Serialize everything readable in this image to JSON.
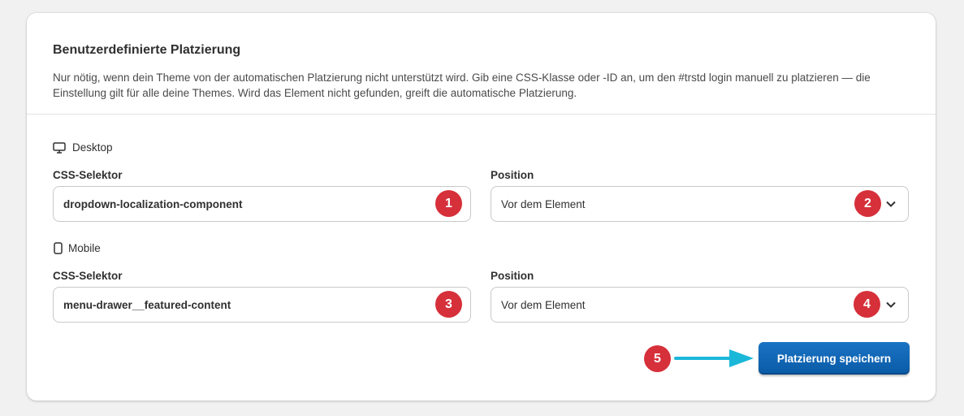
{
  "placement": {
    "title": "Benutzerdefinierte Platzierung",
    "description": "Nur nötig, wenn dein Theme von der automatischen Platzierung nicht unterstützt wird. Gib eine CSS-Klasse oder -ID an, um den #trstd login manuell zu platzieren — die Einstellung gilt für alle deine Themes. Wird das Element nicht gefunden, greift die automatische Platzierung."
  },
  "desktop": {
    "label": "Desktop",
    "icon": "desktop-icon",
    "selector_label": "CSS-Selektor",
    "selector_value": "dropdown-localization-component",
    "position_label": "Position",
    "position_value": "Vor dem Element"
  },
  "mobile": {
    "label": "Mobile",
    "icon": "mobile-icon",
    "selector_label": "CSS-Selektor",
    "selector_value": "menu-drawer__featured-content",
    "position_label": "Position",
    "position_value": "Vor dem Element"
  },
  "save_label": "Platzierung speichern",
  "annotations": [
    "1",
    "2",
    "3",
    "4",
    "5"
  ],
  "colors": {
    "badge": "#d6303a",
    "button": "#1a6bb8",
    "arrow": "#1bb7d9"
  }
}
